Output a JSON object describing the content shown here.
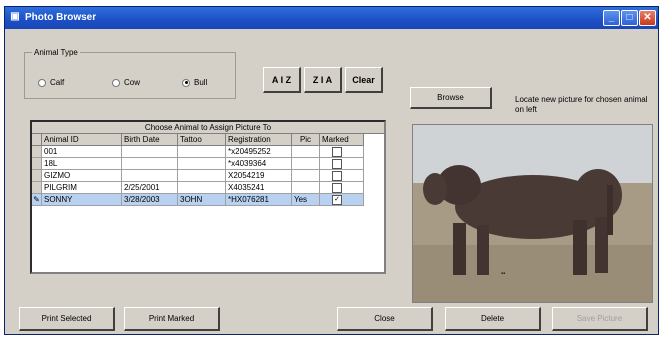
{
  "window": {
    "title": "Photo Browser",
    "icons": [
      "app-icon",
      "minimize-icon",
      "maximize-icon",
      "close-icon"
    ]
  },
  "animal_type": {
    "label": "Animal Type",
    "options": [
      {
        "label": "Calf",
        "selected": false
      },
      {
        "label": "Cow",
        "selected": false
      },
      {
        "label": "Bull",
        "selected": true
      }
    ]
  },
  "sort": {
    "az_label": "A I Z",
    "za_label": "Z I A",
    "clear_label": "Clear"
  },
  "browse": {
    "button_label": "Browse",
    "hint": "Locate new picture for chosen animal on left"
  },
  "grid": {
    "caption": "Choose Animal to Assign Picture To",
    "columns": [
      "Animal ID",
      "Birth Date",
      "Tattoo",
      "Registration",
      "Pic",
      "Marked"
    ],
    "rows": [
      {
        "indicator": "",
        "animal_id": "001",
        "birth_date": "",
        "tattoo": "",
        "registration": "*x20495252",
        "pic": "",
        "marked": false,
        "selected": false
      },
      {
        "indicator": "",
        "animal_id": "18L",
        "birth_date": "",
        "tattoo": "",
        "registration": "*x4039364",
        "pic": "",
        "marked": false,
        "selected": false
      },
      {
        "indicator": "",
        "animal_id": "GIZMO",
        "birth_date": "",
        "tattoo": "",
        "registration": "X2054219",
        "pic": "",
        "marked": false,
        "selected": false
      },
      {
        "indicator": "",
        "animal_id": "PILGRIM",
        "birth_date": "2/25/2001",
        "tattoo": "",
        "registration": "X4035241",
        "pic": "",
        "marked": false,
        "selected": false
      },
      {
        "indicator": "✎",
        "animal_id": "SONNY",
        "birth_date": "3/28/2003",
        "tattoo": "3OHN",
        "registration": "*HX076281",
        "pic": "Yes",
        "marked": true,
        "selected": true
      }
    ]
  },
  "footer": {
    "print_selected": "Print Selected",
    "print_marked": "Print Marked",
    "close": "Close",
    "delete": "Delete",
    "save_picture": "Save Picture"
  },
  "colors": {
    "titlebar": "#1c4fc4",
    "window_bg": "#d4d0c8",
    "selected_row": "#b9d1f0"
  }
}
